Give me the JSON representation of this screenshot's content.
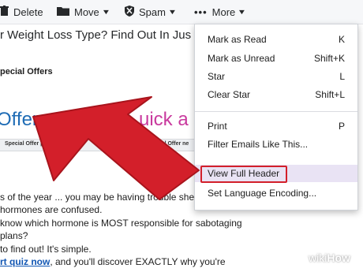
{
  "toolbar": {
    "delete_label": "Delete",
    "move_label": "Move",
    "spam_label": "Spam",
    "more_label": "More"
  },
  "email": {
    "subject_fragment": "r Weight Loss Type? Find Out In Jus",
    "special_offers": "pecial Offers",
    "banner_left": "Offer",
    "banner_right": "uick a",
    "strip_left": "Special Offer partner",
    "strip_right": "Special Offer ne",
    "body_lines": [
      "s of the year ... you may be having trouble shed",
      "hormones are confused.",
      "know which hormone is MOST responsible for sabotaging",
      "plans?",
      "to find out! It's simple."
    ],
    "last_line_link": "rt quiz now",
    "last_line_rest": ", and you'll discover EXACTLY why you're"
  },
  "menu": {
    "items": [
      {
        "label": "Mark as Read",
        "shortcut": "K"
      },
      {
        "label": "Mark as Unread",
        "shortcut": "Shift+K"
      },
      {
        "label": "Star",
        "shortcut": "L"
      },
      {
        "label": "Clear Star",
        "shortcut": "Shift+L"
      },
      {
        "label": "Print",
        "shortcut": "P"
      },
      {
        "label": "Filter Emails Like This...",
        "shortcut": ""
      },
      {
        "label": "View Full Header",
        "shortcut": ""
      },
      {
        "label": "Set Language Encoding...",
        "shortcut": ""
      }
    ],
    "highlighted": "View Full Header"
  },
  "icons": {
    "delete": "trash-icon",
    "move": "folder-icon",
    "spam": "shield-icon",
    "more": "ellipsis-icon"
  },
  "colors": {
    "arrow_red": "#d31f2a",
    "highlight_bg": "#e9e3f4",
    "link_blue": "#1156b3"
  },
  "watermark": {
    "part1": "wiki",
    "part2": "How"
  }
}
